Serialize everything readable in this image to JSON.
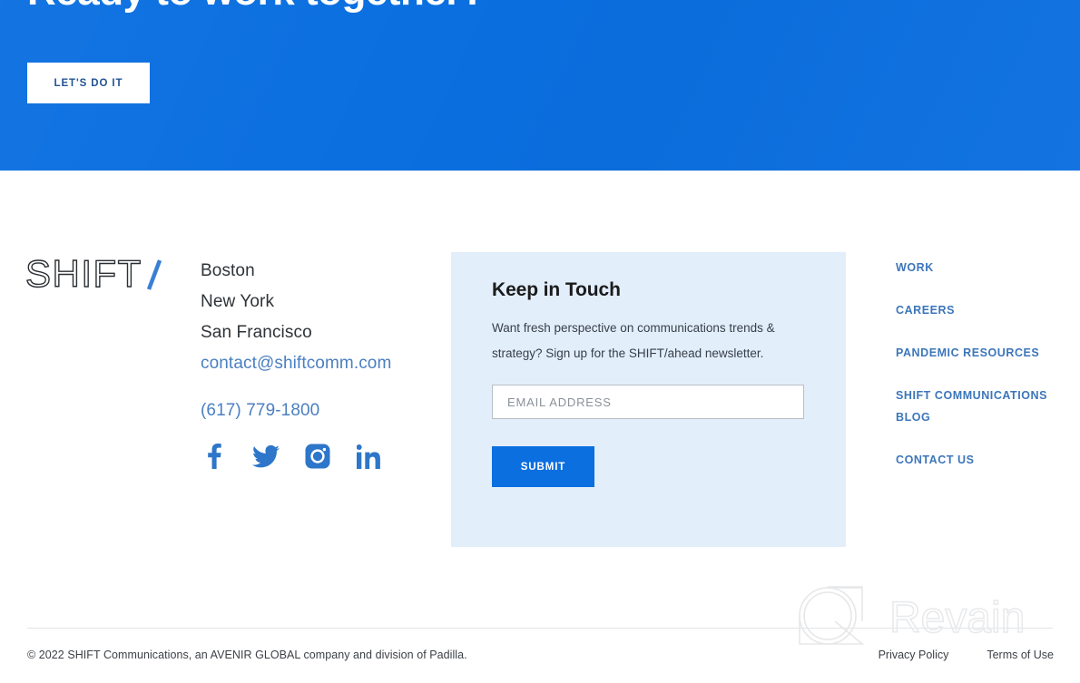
{
  "hero": {
    "title": "Ready to work together?",
    "cta_label": "LET'S DO IT",
    "background_color": "#0b6fe0",
    "cta_text_color": "#1d4f91"
  },
  "footer": {
    "logo_text": "SHIFT/",
    "logo_accent_color": "#3a7fd5",
    "address": {
      "lines": [
        "Boston",
        "New York",
        "San Francisco"
      ],
      "email": "contact@shiftcomm.com",
      "phone": "(617) 779-1800",
      "link_color": "#4a7fc1"
    },
    "socials": [
      {
        "name": "facebook",
        "label": "Facebook"
      },
      {
        "name": "twitter",
        "label": "Twitter"
      },
      {
        "name": "instagram",
        "label": "Instagram"
      },
      {
        "name": "linkedin",
        "label": "LinkedIn"
      }
    ],
    "newsletter": {
      "title": "Keep in Touch",
      "description": "Want fresh perspective on communications trends & strategy? Sign up for the SHIFT/ahead newsletter.",
      "email_value": "",
      "email_placeholder": "EMAIL ADDRESS",
      "submit_label": "SUBMIT",
      "panel_color": "#e3eefb",
      "submit_color": "#0b6fe0"
    },
    "nav_links": [
      "WORK",
      "CAREERS",
      "PANDEMIC RESOURCES",
      "SHIFT COMMUNICATIONS BLOG",
      "CONTACT US"
    ],
    "nav_color": "#3c76ba",
    "copyright": "© 2022 SHIFT Communications, an AVENIR GLOBAL company and division of Padilla.",
    "legal_links": [
      "Privacy Policy",
      "Terms of Use"
    ]
  },
  "watermark": {
    "brand": "Revain",
    "color": "#e8e9eb"
  }
}
